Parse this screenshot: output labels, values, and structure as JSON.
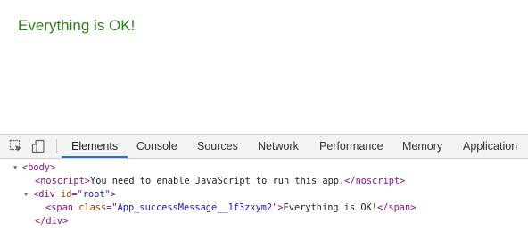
{
  "page": {
    "message": "Everything is OK!"
  },
  "devtools": {
    "tabs": [
      "Elements",
      "Console",
      "Sources",
      "Network",
      "Performance",
      "Memory",
      "Application"
    ],
    "active_tab": "Elements",
    "dom": {
      "body_open": "<body>",
      "noscript_open": "<noscript>",
      "noscript_text": "You need to enable JavaScript to run this app.",
      "noscript_close": "</noscript>",
      "div_open_start": "<div ",
      "div_attr_name": "id",
      "div_attr_eq": "=\"",
      "div_attr_value": "root",
      "div_attr_end": "\">",
      "span_open_start": "<span ",
      "span_attr_name": "class",
      "span_attr_eq": "=\"",
      "span_attr_value": "App_successMessage__1f3zxym2",
      "span_attr_end": "\">",
      "span_text": "Everything is OK!",
      "span_close": "</span>",
      "div_close": "</div>"
    },
    "colors": {
      "tag": "#881280",
      "attr_name": "#994500",
      "attr_value": "#1a1aa6",
      "accent": "#1a73e8",
      "success": "#2e7d1c"
    },
    "icons": [
      "inspect-element-icon",
      "device-toolbar-icon",
      "expand-triangle-icon"
    ]
  }
}
